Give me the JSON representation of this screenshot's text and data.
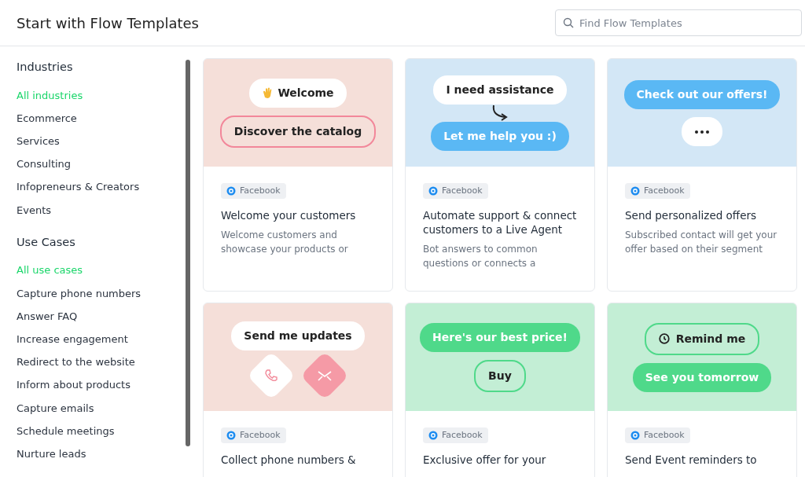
{
  "header": {
    "title": "Start with Flow Templates",
    "search": {
      "placeholder": "Find Flow Templates"
    }
  },
  "sidebar": {
    "sections": [
      {
        "title": "Industries",
        "items": [
          {
            "label": "All industries",
            "selected": true
          },
          {
            "label": "Ecommerce",
            "selected": false
          },
          {
            "label": "Services",
            "selected": false
          },
          {
            "label": "Consulting",
            "selected": false
          },
          {
            "label": "Infopreneurs & Creators",
            "selected": false
          },
          {
            "label": "Events",
            "selected": false
          }
        ]
      },
      {
        "title": "Use Cases",
        "items": [
          {
            "label": "All use cases",
            "selected": true
          },
          {
            "label": "Capture phone numbers",
            "selected": false
          },
          {
            "label": "Answer FAQ",
            "selected": false
          },
          {
            "label": "Increase engagement",
            "selected": false
          },
          {
            "label": "Redirect to the website",
            "selected": false
          },
          {
            "label": "Inform about products",
            "selected": false
          },
          {
            "label": "Capture emails",
            "selected": false
          },
          {
            "label": "Schedule meetings",
            "selected": false
          },
          {
            "label": "Nurture leads",
            "selected": false
          }
        ]
      }
    ]
  },
  "templates": [
    {
      "color": "#f5dfd9",
      "bubbles": [
        {
          "kind": "plain-wave",
          "text": "Welcome",
          "color": "#ffffff"
        },
        {
          "kind": "outline",
          "text": "Discover the catalog",
          "color": "#f2879a"
        }
      ],
      "channel": "Facebook",
      "title": "Welcome your customers",
      "description": "Welcome customers and showcase your products or"
    },
    {
      "color": "#d3e7f6",
      "bubbles": [
        {
          "kind": "plain",
          "text": "I need assistance",
          "color": "#ffffff"
        },
        {
          "kind": "arrow"
        },
        {
          "kind": "filled",
          "text": "Let me help you :)",
          "color": "#5ab8f4"
        }
      ],
      "channel": "Facebook",
      "title": "Automate support & connect customers to a Live Agent",
      "description": "Bot answers to common questions or connects a"
    },
    {
      "color": "#d3e7f6",
      "bubbles": [
        {
          "kind": "filled",
          "text": "Check out our offers!",
          "color": "#5ab8f4"
        },
        {
          "kind": "typing",
          "color": "#ffffff"
        }
      ],
      "channel": "Facebook",
      "title": "Send personalized offers",
      "description": "Subscribed contact will get your offer based on their segment"
    },
    {
      "color": "#f5dfd9",
      "bubbles": [
        {
          "kind": "plain",
          "text": "Send me updates",
          "color": "#ffffff"
        },
        {
          "kind": "phone-tile",
          "color": "#ffffff"
        },
        {
          "kind": "mail-tile",
          "color": "#f59aa6"
        }
      ],
      "channel": "Facebook",
      "title": "Collect phone numbers &"
    },
    {
      "color": "#c3eed5",
      "bubbles": [
        {
          "kind": "filled",
          "text": "Here's our best price!",
          "color": "#4fd98a"
        },
        {
          "kind": "outline",
          "text": "Buy",
          "color": "#4fd98a"
        }
      ],
      "channel": "Facebook",
      "title": "Exclusive offer for your"
    },
    {
      "color": "#c3eed5",
      "bubbles": [
        {
          "kind": "outline-clock",
          "text": "Remind me",
          "color": "#4fd98a"
        },
        {
          "kind": "filled",
          "text": "See you tomorrow",
          "color": "#4fd98a"
        }
      ],
      "channel": "Facebook",
      "title": "Send Event reminders to"
    }
  ]
}
